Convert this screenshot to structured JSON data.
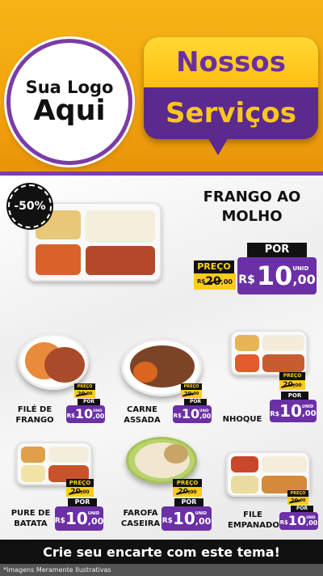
{
  "logo": {
    "line1": "Sua Logo",
    "line2": "Aqui"
  },
  "banner": {
    "line1": "Nossos",
    "line2": "Serviços"
  },
  "discount_badge": "-50%",
  "featured": {
    "name_line1": "FRANGO AO",
    "name_line2": "MOLHO",
    "preco_label": "PREÇO",
    "old_price": "20",
    "old_cents": ",00",
    "old_prefix": "R$",
    "por_label": "POR",
    "currency": "R$",
    "price_int": "10",
    "price_cents": ",00",
    "unit": "UNID"
  },
  "items": [
    {
      "name_line1": "FILÉ DE",
      "name_line2": "FRANGO",
      "preco_label": "PREÇO",
      "old_price": "20",
      "old_cents": ",00",
      "por_label": "POR",
      "currency": "R$",
      "price_int": "10",
      "price_cents": ",00",
      "unit": "UNID"
    },
    {
      "name_line1": "CARNE",
      "name_line2": "ASSADA",
      "preco_label": "PREÇO",
      "old_price": "20",
      "old_cents": ",00",
      "por_label": "POR",
      "currency": "R$",
      "price_int": "10",
      "price_cents": ",00",
      "unit": "UNID"
    },
    {
      "name_line1": "NHOQUE",
      "name_line2": "",
      "preco_label": "PREÇO",
      "old_price": "20",
      "old_cents": ",00",
      "por_label": "POR",
      "currency": "R$",
      "price_int": "10",
      "price_cents": ",00",
      "unit": "UNID"
    },
    {
      "name_line1": "PURE DE",
      "name_line2": "BATATA",
      "preco_label": "PREÇO",
      "old_price": "20",
      "old_cents": ",00",
      "por_label": "POR",
      "currency": "R$",
      "price_int": "10",
      "price_cents": ",00",
      "unit": "UNID"
    },
    {
      "name_line1": "FAROFA",
      "name_line2": "CASEIRA",
      "preco_label": "PREÇO",
      "old_price": "20",
      "old_cents": ",00",
      "por_label": "POR",
      "currency": "R$",
      "price_int": "10",
      "price_cents": ",00",
      "unit": "UNID"
    },
    {
      "name_line1": "FILE",
      "name_line2": "EMPANADO",
      "preco_label": "PREÇO",
      "old_price": "20",
      "old_cents": ",00",
      "por_label": "POR",
      "currency": "R$",
      "price_int": "10",
      "price_cents": ",00",
      "unit": "UNID"
    }
  ],
  "cta": "Crie seu encarte com este tema!",
  "disclaimer": "*Imagens Meramente Ilustrativas",
  "colors": {
    "header": "#f1a60e",
    "purple": "#6b2fa6",
    "yellow": "#ffcc17",
    "black": "#111111"
  }
}
